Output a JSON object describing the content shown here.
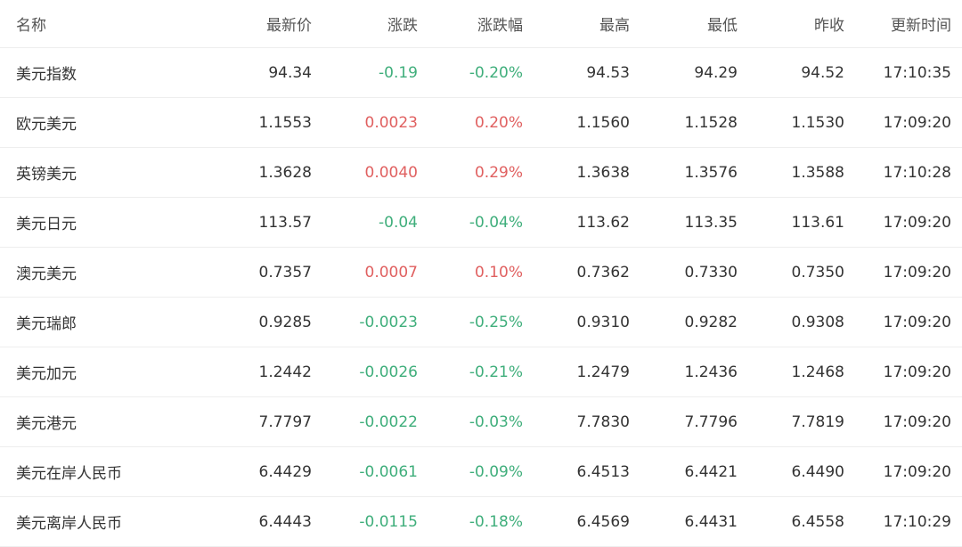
{
  "colors": {
    "up": "#e06060",
    "down": "#3fae7b",
    "text": "#333333",
    "header": "#555555",
    "border": "#eeeeee"
  },
  "table": {
    "headers": [
      "名称",
      "最新价",
      "涨跌",
      "涨跌幅",
      "最高",
      "最低",
      "昨收",
      "更新时间"
    ],
    "rows": [
      {
        "name": "美元指数",
        "last": "94.34",
        "change": "-0.19",
        "pct": "-0.20%",
        "high": "94.53",
        "low": "94.29",
        "prev": "94.52",
        "time": "17:10:35",
        "dir": "down"
      },
      {
        "name": "欧元美元",
        "last": "1.1553",
        "change": "0.0023",
        "pct": "0.20%",
        "high": "1.1560",
        "low": "1.1528",
        "prev": "1.1530",
        "time": "17:09:20",
        "dir": "up"
      },
      {
        "name": "英镑美元",
        "last": "1.3628",
        "change": "0.0040",
        "pct": "0.29%",
        "high": "1.3638",
        "low": "1.3576",
        "prev": "1.3588",
        "time": "17:10:28",
        "dir": "up"
      },
      {
        "name": "美元日元",
        "last": "113.57",
        "change": "-0.04",
        "pct": "-0.04%",
        "high": "113.62",
        "low": "113.35",
        "prev": "113.61",
        "time": "17:09:20",
        "dir": "down"
      },
      {
        "name": "澳元美元",
        "last": "0.7357",
        "change": "0.0007",
        "pct": "0.10%",
        "high": "0.7362",
        "low": "0.7330",
        "prev": "0.7350",
        "time": "17:09:20",
        "dir": "up"
      },
      {
        "name": "美元瑞郎",
        "last": "0.9285",
        "change": "-0.0023",
        "pct": "-0.25%",
        "high": "0.9310",
        "low": "0.9282",
        "prev": "0.9308",
        "time": "17:09:20",
        "dir": "down"
      },
      {
        "name": "美元加元",
        "last": "1.2442",
        "change": "-0.0026",
        "pct": "-0.21%",
        "high": "1.2479",
        "low": "1.2436",
        "prev": "1.2468",
        "time": "17:09:20",
        "dir": "down"
      },
      {
        "name": "美元港元",
        "last": "7.7797",
        "change": "-0.0022",
        "pct": "-0.03%",
        "high": "7.7830",
        "low": "7.7796",
        "prev": "7.7819",
        "time": "17:09:20",
        "dir": "down"
      },
      {
        "name": "美元在岸人民币",
        "last": "6.4429",
        "change": "-0.0061",
        "pct": "-0.09%",
        "high": "6.4513",
        "low": "6.4421",
        "prev": "6.4490",
        "time": "17:09:20",
        "dir": "down"
      },
      {
        "name": "美元离岸人民币",
        "last": "6.4443",
        "change": "-0.0115",
        "pct": "-0.18%",
        "high": "6.4569",
        "low": "6.4431",
        "prev": "6.4558",
        "time": "17:10:29",
        "dir": "down"
      }
    ]
  }
}
